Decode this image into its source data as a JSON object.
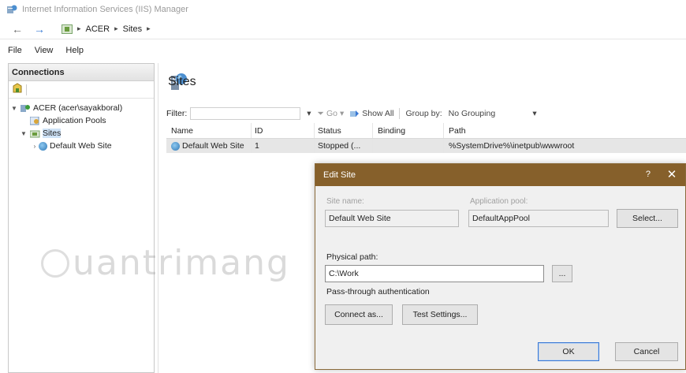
{
  "window": {
    "title": "Internet Information Services (IIS) Manager"
  },
  "address": {
    "segments": [
      "ACER",
      "Sites"
    ],
    "separator": "▸"
  },
  "menu": {
    "items": [
      "File",
      "View",
      "Help"
    ]
  },
  "connections": {
    "header": "Connections",
    "tree": {
      "server": "ACER (acer\\sayakboral)",
      "app_pools": "Application Pools",
      "sites": "Sites",
      "default_site": "Default Web Site"
    }
  },
  "main": {
    "heading": "Sites",
    "filter": {
      "label": "Filter:",
      "go": "Go",
      "show_all": "Show All",
      "group_by_label": "Group by:",
      "group_by_value": "No Grouping"
    },
    "columns": [
      "Name",
      "ID",
      "Status",
      "Binding",
      "Path"
    ],
    "rows": [
      {
        "name": "Default Web Site",
        "id": "1",
        "status": "Stopped (...",
        "binding": "",
        "path": "%SystemDrive%\\inetpub\\wwwroot"
      }
    ]
  },
  "watermark": {
    "text": "uantrimang"
  },
  "dialog": {
    "title": "Edit Site",
    "help": "?",
    "close": "✕",
    "site_name_label": "Site name:",
    "site_name_value": "Default Web Site",
    "app_pool_label": "Application pool:",
    "app_pool_value": "DefaultAppPool",
    "select_button": "Select...",
    "physical_path_label": "Physical path:",
    "physical_path_value": "C:\\Work",
    "browse_button": "...",
    "passthrough_label": "Pass-through authentication",
    "connect_as_button": "Connect as...",
    "test_settings_button": "Test Settings...",
    "ok_button": "OK",
    "cancel_button": "Cancel"
  },
  "colors": {
    "dialog_title_bg": "#86602b",
    "selected_row": "#e6e6e6",
    "tree_selection": "#cfe3f7"
  }
}
